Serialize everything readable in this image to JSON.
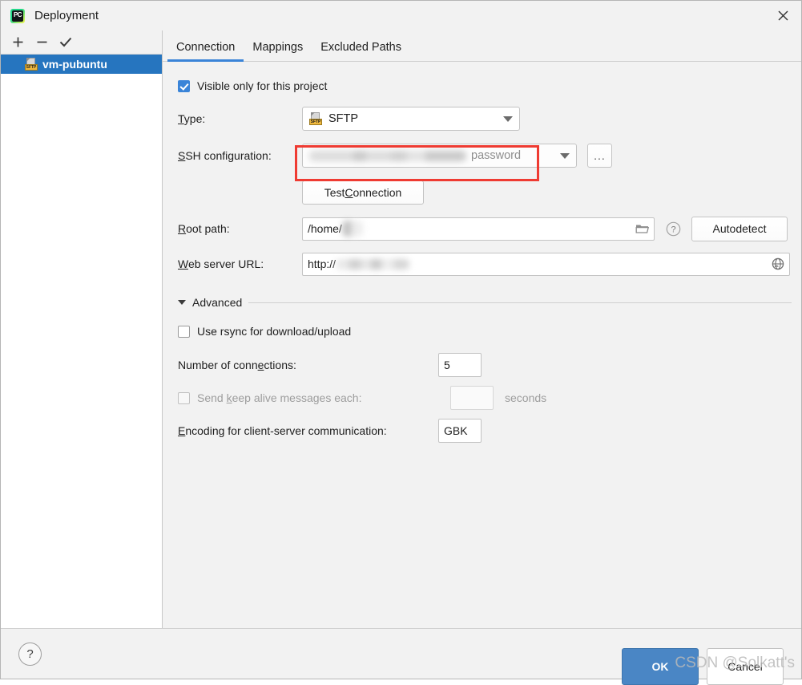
{
  "window": {
    "title": "Deployment",
    "app_icon": "pycharm-icon",
    "app_icon_text": "PC",
    "close_icon": "close-icon"
  },
  "sidebar": {
    "toolbar": [
      {
        "name": "add-button",
        "label": "+"
      },
      {
        "name": "remove-button",
        "label": "−"
      },
      {
        "name": "apply-default-button",
        "label": "✓"
      }
    ],
    "items": [
      {
        "label": "vm-pubuntu",
        "icon": "sftp-server-icon",
        "icon_label": "SFTP",
        "selected": true
      }
    ]
  },
  "tabs": [
    {
      "label": "Connection",
      "active": true
    },
    {
      "label": "Mappings",
      "active": false
    },
    {
      "label": "Excluded Paths",
      "active": false
    }
  ],
  "form": {
    "visible_only_checkbox": {
      "label": "Visible only for this project",
      "checked": true
    },
    "type": {
      "label": "Type:",
      "value": "SFTP",
      "icon": "sftp-type-icon",
      "icon_label": "SFTP",
      "highlight_color": "#ef3b32"
    },
    "ssh_configuration": {
      "label": "SSH configuration:",
      "value": "",
      "value_redacted": true,
      "suffix": "password",
      "browse_button": "..."
    },
    "test_connection_button": "Test Connection",
    "root_path": {
      "label": "Root path:",
      "value": "/home/",
      "value_redacted": true,
      "folder_icon": "folder-icon",
      "help_icon": "help-icon",
      "autodetect_button": "Autodetect"
    },
    "web_server_url": {
      "label": "Web server URL:",
      "value": "http://",
      "value_redacted": true,
      "globe_icon": "globe-icon"
    },
    "advanced": {
      "label": "Advanced",
      "expanded": true,
      "use_rsync": {
        "label": "Use rsync for download/upload",
        "checked": false
      },
      "number_of_connections": {
        "label": "Number of connections:",
        "value": "5"
      },
      "keep_alive": {
        "label": "Send keep alive messages each:",
        "checked": false,
        "enabled": false,
        "value": "",
        "unit": "seconds"
      },
      "encoding": {
        "label": "Encoding for client-server communication:",
        "value": "GBK"
      }
    }
  },
  "footer": {
    "help_button": "?",
    "ok_button": "OK",
    "cancel_button": "Cancel",
    "watermark": "CSDN @Solkatt's"
  }
}
